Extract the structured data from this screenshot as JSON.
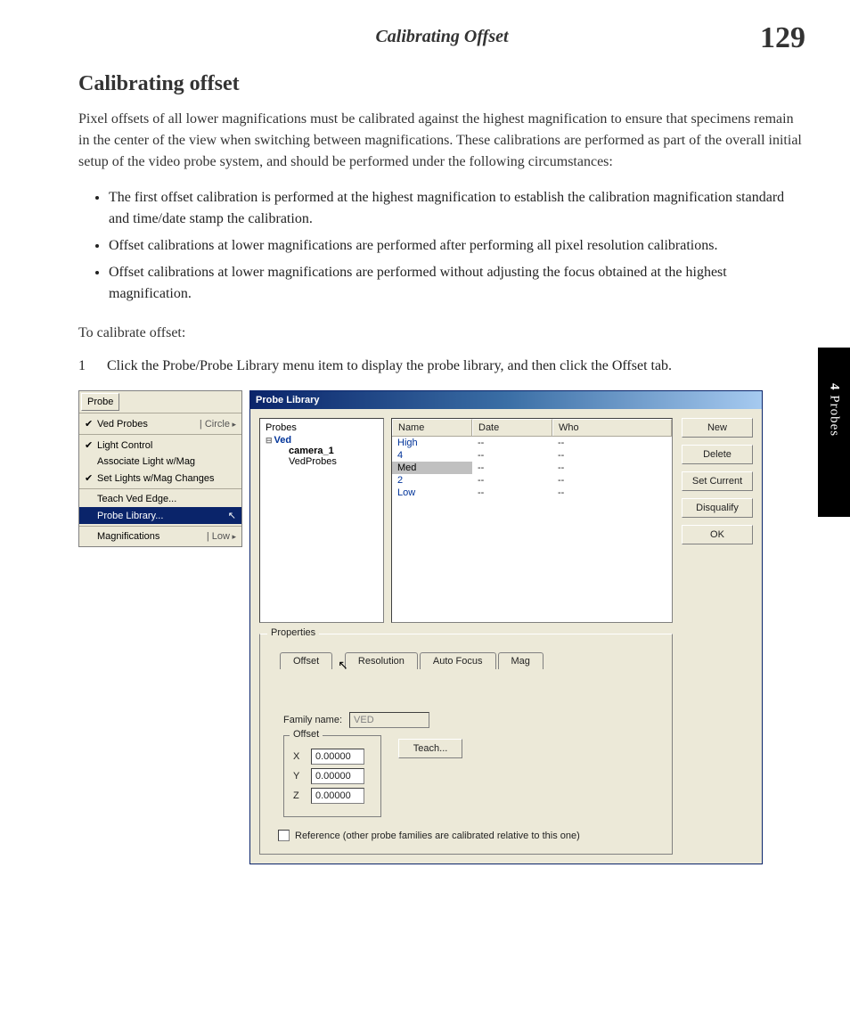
{
  "header": {
    "running_title": "Calibrating Offset",
    "page_number": "129"
  },
  "sidetab": {
    "chapter_num": "4",
    "chapter_name": "Probes"
  },
  "section": {
    "title": "Calibrating offset",
    "intro": "Pixel offsets of all lower magnifications must be calibrated against the highest magnification to ensure that specimens remain in the center of the view when switching between magnifications.  These calibrations are performed as part of the overall initial setup of the video probe system, and should be performed under the following circumstances:",
    "bullets": [
      "The first offset calibration is performed at the highest magnification to establish the calibration magnification standard and time/date stamp the calibration.",
      "Offset calibrations at lower magnifications are performed after performing all pixel resolution calibrations.",
      "Offset calibrations at lower magnifications are performed without adjusting the focus obtained at the highest magnification."
    ],
    "lead_in": "To calibrate offset:",
    "step1_num": "1",
    "step1_text": "Click the Probe/Probe Library menu item to display the probe library, and then click the Offset tab."
  },
  "probe_menu": {
    "title": "Probe",
    "items": {
      "ved_probes": "Ved Probes",
      "circle": "Circle",
      "light_control": "Light Control",
      "assoc_light": "Associate Light w/Mag",
      "set_lights": "Set Lights w/Mag Changes",
      "teach_ved": "Teach Ved Edge...",
      "probe_library": "Probe Library...",
      "magnifications": "Magnifications",
      "low": "Low"
    }
  },
  "probe_library": {
    "title": "Probe Library",
    "tree": {
      "header": "Probes",
      "root": "Ved",
      "child1": "camera_1",
      "child2": "VedProbes"
    },
    "columns": {
      "name": "Name",
      "date": "Date",
      "who": "Who"
    },
    "rows": [
      {
        "name": "High",
        "date": "--",
        "who": "--"
      },
      {
        "name": "4",
        "date": "--",
        "who": "--"
      },
      {
        "name": "Med",
        "date": "--",
        "who": "--"
      },
      {
        "name": "2",
        "date": "--",
        "who": "--"
      },
      {
        "name": "Low",
        "date": "--",
        "who": "--"
      }
    ],
    "buttons": {
      "new": "New",
      "delete": "Delete",
      "set_current": "Set Current",
      "disqualify": "Disqualify",
      "ok": "OK"
    },
    "properties": {
      "legend": "Properties",
      "tabs": {
        "offset": "Offset",
        "resolution": "Resolution",
        "autofocus": "Auto Focus",
        "mag": "Mag"
      },
      "family_label": "Family name:",
      "family_value": "VED",
      "offset_legend": "Offset",
      "x_label": "X",
      "x_value": "0.00000",
      "y_label": "Y",
      "y_value": "0.00000",
      "z_label": "Z",
      "z_value": "0.00000",
      "teach": "Teach...",
      "reference": "Reference (other probe families are calibrated relative to this one)"
    }
  }
}
